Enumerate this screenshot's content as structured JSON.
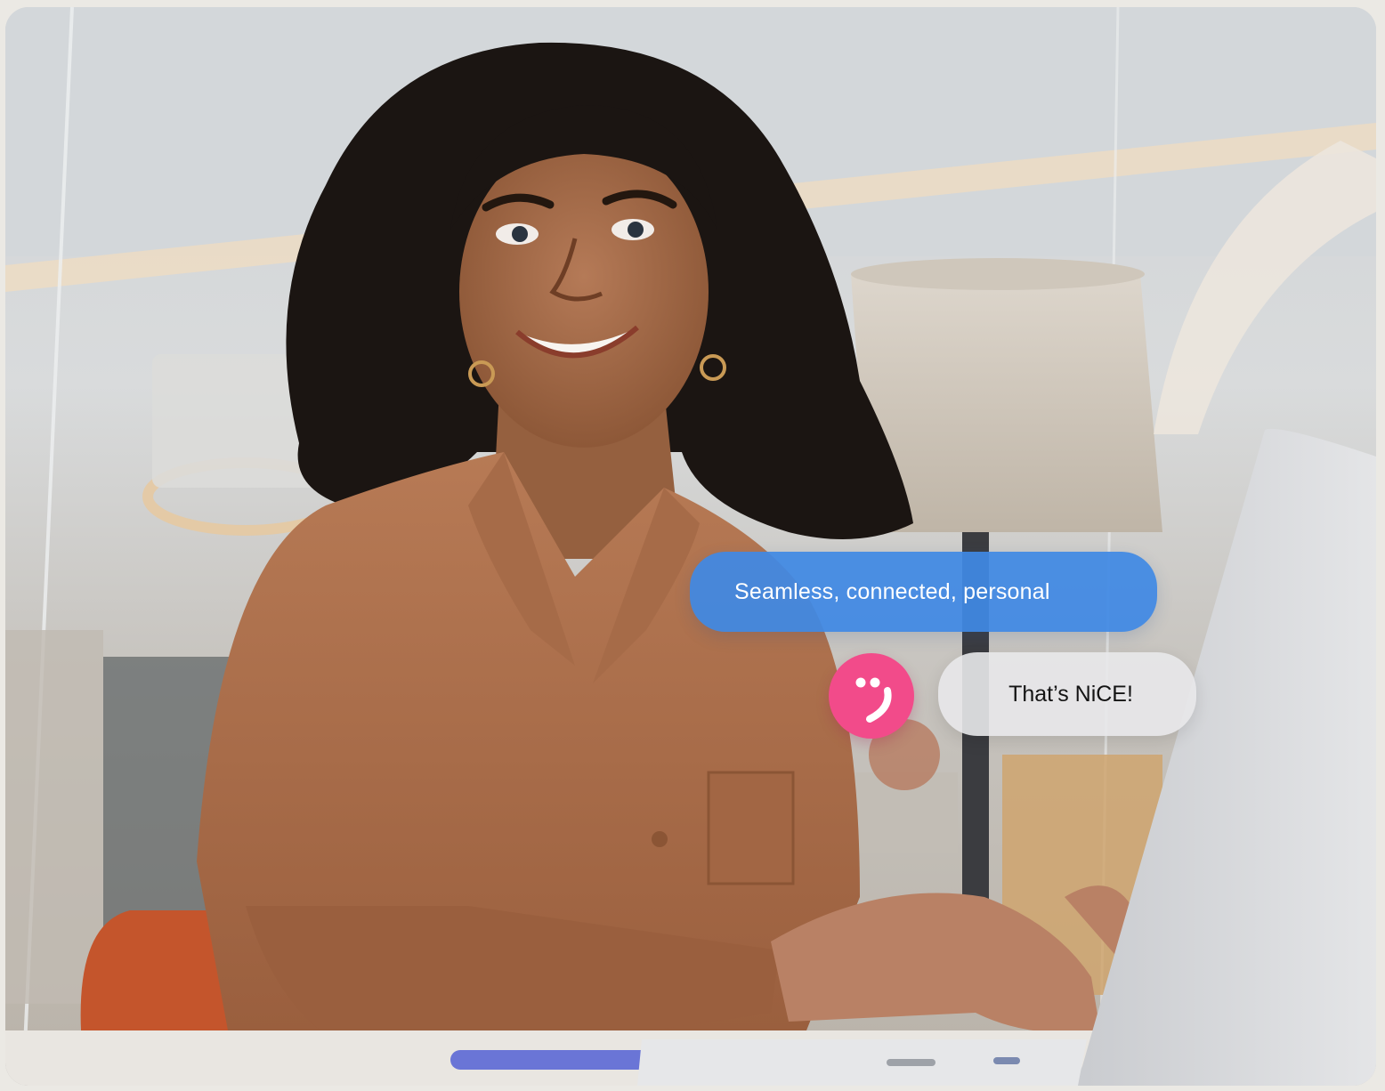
{
  "hero": {
    "photo_description_icon": "woman-at-laptop-photo",
    "chat": {
      "message_blue": "Seamless, connected, personal",
      "message_gray": "That’s NiCE!",
      "avatar_icon": "smiley-icon"
    }
  },
  "colors": {
    "blue_bubble": "#4089e4",
    "gray_bubble": "#e8e8ea",
    "smiley": "#f24b8a",
    "page_background": "#ebe9e4"
  }
}
